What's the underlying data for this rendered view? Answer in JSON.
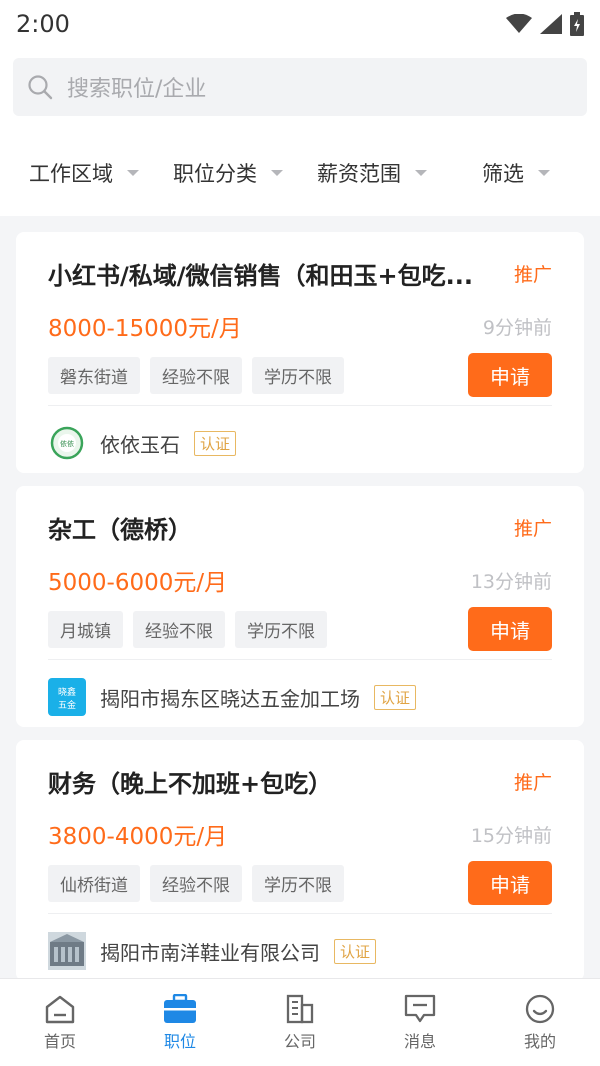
{
  "status_bar": {
    "time": "2:00"
  },
  "search": {
    "placeholder": "搜索职位/企业"
  },
  "filters": [
    {
      "label": "工作区域"
    },
    {
      "label": "职位分类"
    },
    {
      "label": "薪资范围"
    },
    {
      "label": "筛选"
    }
  ],
  "jobs": [
    {
      "title": "小红书/私域/微信销售（和田玉+包吃...",
      "promo": "推广",
      "salary": "8000-15000元/月",
      "time": "9分钟前",
      "tags": [
        "磐东街道",
        "经验不限",
        "学历不限"
      ],
      "apply": "申请",
      "company": "依依玉石",
      "cert": "认证",
      "logo_text": "依依"
    },
    {
      "title": "杂工（德桥）",
      "promo": "推广",
      "salary": "5000-6000元/月",
      "time": "13分钟前",
      "tags": [
        "月城镇",
        "经验不限",
        "学历不限"
      ],
      "apply": "申请",
      "company": "揭阳市揭东区晓达五金加工场",
      "cert": "认证",
      "logo_text": "晓鑫五金"
    },
    {
      "title": "财务（晚上不加班+包吃）",
      "promo": "推广",
      "salary": "3800-4000元/月",
      "time": "15分钟前",
      "tags": [
        "仙桥街道",
        "经验不限",
        "学历不限"
      ],
      "apply": "申请",
      "company": "揭阳市南洋鞋业有限公司",
      "cert": "认证"
    }
  ],
  "bottom_nav": [
    {
      "label": "首页",
      "icon": "home-icon"
    },
    {
      "label": "职位",
      "icon": "briefcase-icon",
      "active": true
    },
    {
      "label": "公司",
      "icon": "building-icon"
    },
    {
      "label": "消息",
      "icon": "message-icon"
    },
    {
      "label": "我的",
      "icon": "profile-icon"
    }
  ],
  "colors": {
    "accent": "#ff6b1a",
    "nav_active": "#1e88e5",
    "cert": "#e0a445"
  }
}
